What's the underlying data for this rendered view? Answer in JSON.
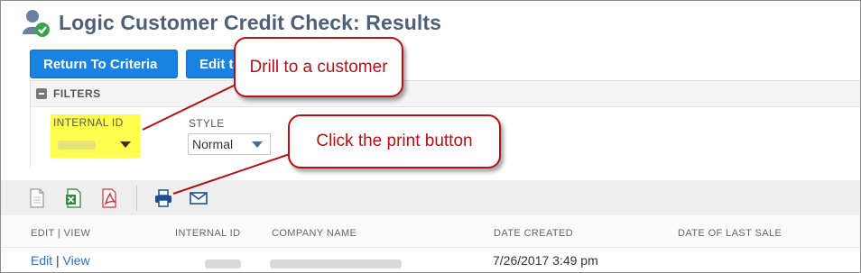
{
  "page": {
    "title": "Logic Customer Credit Check: Results"
  },
  "buttons": {
    "return_to_criteria": "Return To Criteria",
    "edit_partial": "Edit t"
  },
  "filters": {
    "header": "FILTERS",
    "internal_id_label": "INTERNAL ID",
    "style_label": "STYLE",
    "style_value": "Normal"
  },
  "toolbar": {
    "icons": [
      "document-icon",
      "excel-icon",
      "pdf-icon",
      "print-icon",
      "email-icon"
    ]
  },
  "table": {
    "columns": [
      "EDIT | VIEW",
      "INTERNAL ID",
      "COMPANY NAME",
      "DATE CREATED",
      "DATE OF LAST SALE"
    ],
    "rows": [
      {
        "edit": "Edit",
        "separator": "|",
        "view": "View",
        "date_created": "7/26/2017 3:49 pm",
        "date_of_last_sale": ""
      }
    ]
  },
  "callouts": {
    "drill": "Drill to a customer",
    "print": "Click the print button"
  },
  "colors": {
    "primary_button": "#1a82e2",
    "title": "#4d5f79",
    "callout": "#b01317",
    "highlight": "#ffff4d",
    "link": "#2a6fc0"
  }
}
